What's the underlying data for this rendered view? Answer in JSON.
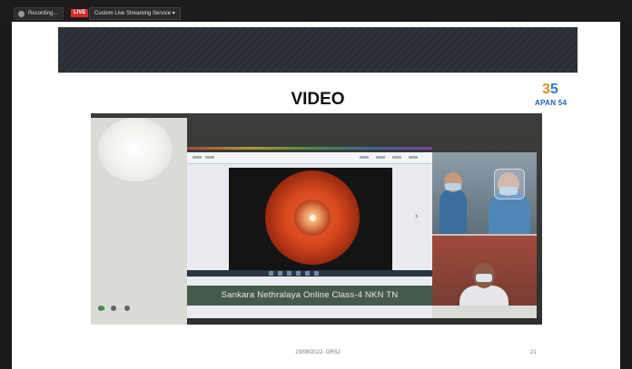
{
  "toolbar": {
    "recording_label": "Recording...",
    "live_label": "LIVE",
    "stream_label": "Custom Live Streaming Service",
    "stream_chevron": "▾",
    "recording_icon": "cloud-record-icon"
  },
  "slide": {
    "title": "VIDEO",
    "logo_number_a": "3",
    "logo_number_b": "5",
    "logo_text": "APAN 54",
    "footer": "23/08/2022- DRSJ",
    "page_number": "21"
  },
  "video": {
    "caption": "Sankara Nethralaya Online Class-4 NKN TN",
    "next_arrow": "›"
  },
  "colors": {
    "live_badge": "#d62b2b",
    "logo_orange": "#e58a1f",
    "logo_blue": "#1f5fae"
  }
}
